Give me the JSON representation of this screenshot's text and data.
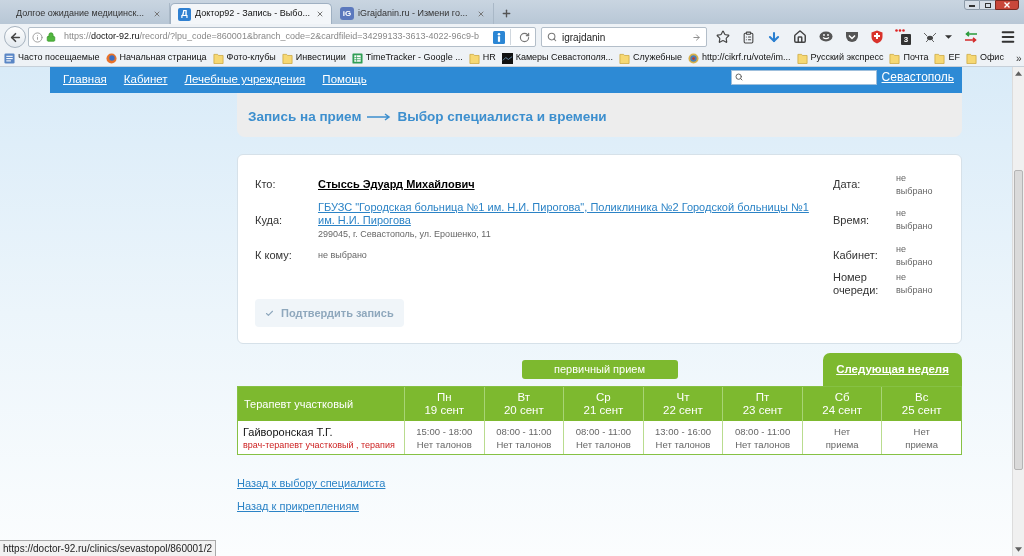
{
  "browser": {
    "tabs": [
      {
        "title": "Долгое ожидание медицинск...",
        "selected": false
      },
      {
        "title": "Доктор92 - Запись - Выбо...",
        "selected": true,
        "favicon_text": "Д"
      },
      {
        "title": "iGrajdanin.ru - Измени го...",
        "selected": false,
        "favicon_text": "iG"
      }
    ],
    "address": {
      "scheme": "https://",
      "host": "doctor-92.ru",
      "path": "/record/?lpu_code=860001&branch_code=2&cardfileid=34299133-3613-4022-96c9-b"
    },
    "search": {
      "value": "igrajdanin"
    },
    "toolbar_badge": "3",
    "bookmarks": [
      {
        "label": "Часто посещаемые",
        "kind": "smart"
      },
      {
        "label": "Начальная страница",
        "kind": "home"
      },
      {
        "label": "Фото-клубы",
        "kind": "folder"
      },
      {
        "label": "Инвестиции",
        "kind": "folder"
      },
      {
        "label": "TimeTracker - Google ...",
        "kind": "sheet"
      },
      {
        "label": "HR",
        "kind": "folder"
      },
      {
        "label": "Камеры Севастополя...",
        "kind": "camera"
      },
      {
        "label": "Служебные",
        "kind": "folder"
      },
      {
        "label": "http://cikrf.ru/vote/im...",
        "kind": "emblem"
      },
      {
        "label": "Русский экспресс",
        "kind": "folder"
      },
      {
        "label": "Почта",
        "kind": "folder"
      },
      {
        "label": "EF",
        "kind": "folder"
      },
      {
        "label": "Офис",
        "kind": "folder"
      }
    ],
    "bookmarks_more": "»"
  },
  "site_nav": {
    "links": [
      "Главная",
      "Кабинет",
      "Лечебные учреждения",
      "Помощь"
    ],
    "city_link": "Севастополь"
  },
  "breadcrumb": {
    "steps": [
      "Запись на прием",
      "Выбор специалиста и времени"
    ]
  },
  "booking": {
    "fields": [
      {
        "label": "Кто:",
        "kind": "person",
        "value": "Стыссь Эдуард Михайлович"
      },
      {
        "label": "Куда:",
        "kind": "place",
        "value": "ГБУЗС \"Городская больница №1 им. Н.И. Пирогова\", Поликлиника №2 Городской больницы №1 им. Н.И. Пирогова",
        "address": "299045, г. Севастополь, ул. Ерошенко, 11"
      },
      {
        "label": "К кому:",
        "kind": "text",
        "value": "не выбрано"
      }
    ],
    "summary": [
      {
        "label": "Дата:",
        "value": "не выбрано"
      },
      {
        "label": "Время:",
        "value": "не выбрано"
      },
      {
        "label": "Кабинет:",
        "value": "не выбрано"
      },
      {
        "label": "Номер очереди:",
        "value": "не выбрано"
      }
    ],
    "confirm_button": {
      "label": "Подтвердить запись",
      "disabled": true
    }
  },
  "schedule": {
    "reception_type": "первичный прием",
    "next_week_tab": "Следующая неделя",
    "specialty": "Терапевт участковый",
    "days": [
      {
        "day": "Пн",
        "date": "19 сент"
      },
      {
        "day": "Вт",
        "date": "20 сент"
      },
      {
        "day": "Ср",
        "date": "21 сент"
      },
      {
        "day": "Чт",
        "date": "22 сент"
      },
      {
        "day": "Пт",
        "date": "23 сент"
      },
      {
        "day": "Сб",
        "date": "24 сент"
      },
      {
        "day": "Вс",
        "date": "25 сент"
      }
    ],
    "doctors": [
      {
        "name": "Гайворонская Т.Г.",
        "role": "врач-терапевт участковый , терапия",
        "slots": [
          {
            "kind": "hours",
            "time": "15:00 - 18:00",
            "status": "Нет талонов"
          },
          {
            "kind": "hours",
            "time": "08:00 - 11:00",
            "status": "Нет талонов"
          },
          {
            "kind": "hours",
            "time": "08:00 - 11:00",
            "status": "Нет талонов"
          },
          {
            "kind": "hours",
            "time": "13:00 - 16:00",
            "status": "Нет талонов"
          },
          {
            "kind": "hours",
            "time": "08:00 - 11:00",
            "status": "Нет талонов"
          },
          {
            "kind": "closed",
            "status": "Нет приема"
          },
          {
            "kind": "closed",
            "status": "Нет приема"
          }
        ]
      }
    ]
  },
  "back_links": [
    "Назад к выбору специалиста",
    "Назад к прикреплениям"
  ],
  "status_bar": {
    "url": "https://doctor-92.ru/clinics/sevastopol/860001/2"
  }
}
